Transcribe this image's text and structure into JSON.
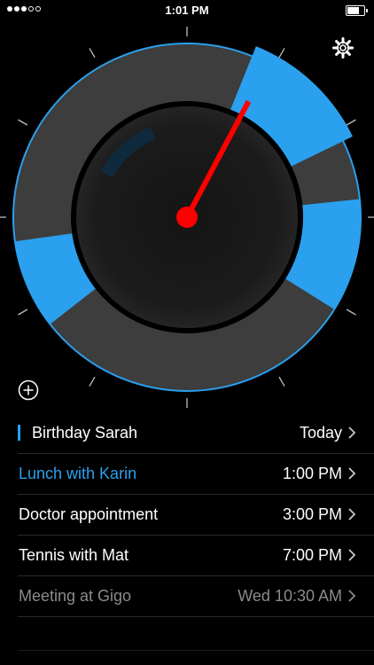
{
  "status_bar": {
    "time": "1:01 PM",
    "signal_bars_filled": 3,
    "signal_bars_total": 5
  },
  "dial": {
    "accent_color": "#2aa0ee",
    "hand_color": "#ff0000",
    "track_color": "#3d3d3d"
  },
  "icons": {
    "settings": "gear-icon",
    "add": "plus-circle-icon",
    "row_chevron": "chevron-right-icon"
  },
  "events": [
    {
      "title": "Birthday Sarah",
      "when": "Today",
      "style": "marked"
    },
    {
      "title": "Lunch with Karin",
      "when": "1:00 PM",
      "style": "blue"
    },
    {
      "title": "Doctor appointment",
      "when": "3:00 PM",
      "style": "normal"
    },
    {
      "title": "Tennis with Mat",
      "when": "7:00 PM",
      "style": "normal"
    },
    {
      "title": "Meeting at Gigo",
      "when": "Wed 10:30 AM",
      "style": "dim"
    }
  ]
}
